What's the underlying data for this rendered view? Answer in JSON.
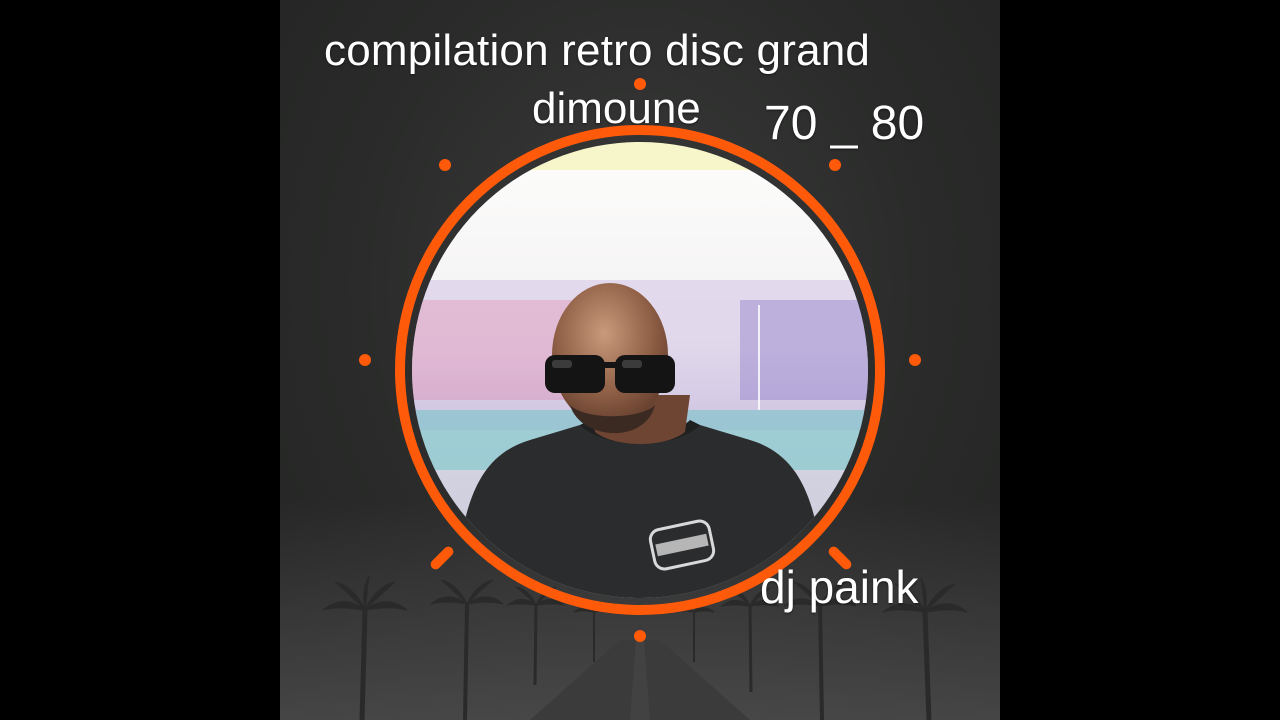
{
  "title": {
    "line1": "compilation retro disc grand",
    "line2": "dimoune",
    "years": "70 _ 80"
  },
  "artist": "dj paink",
  "colors": {
    "accent": "#ff5a0a",
    "background": "#2c2d2c",
    "text": "#ffffff"
  },
  "icons": {
    "portrait": "man-with-sunglasses-portrait",
    "palms": "palm-tree-silhouettes",
    "road": "road-silhouette"
  }
}
